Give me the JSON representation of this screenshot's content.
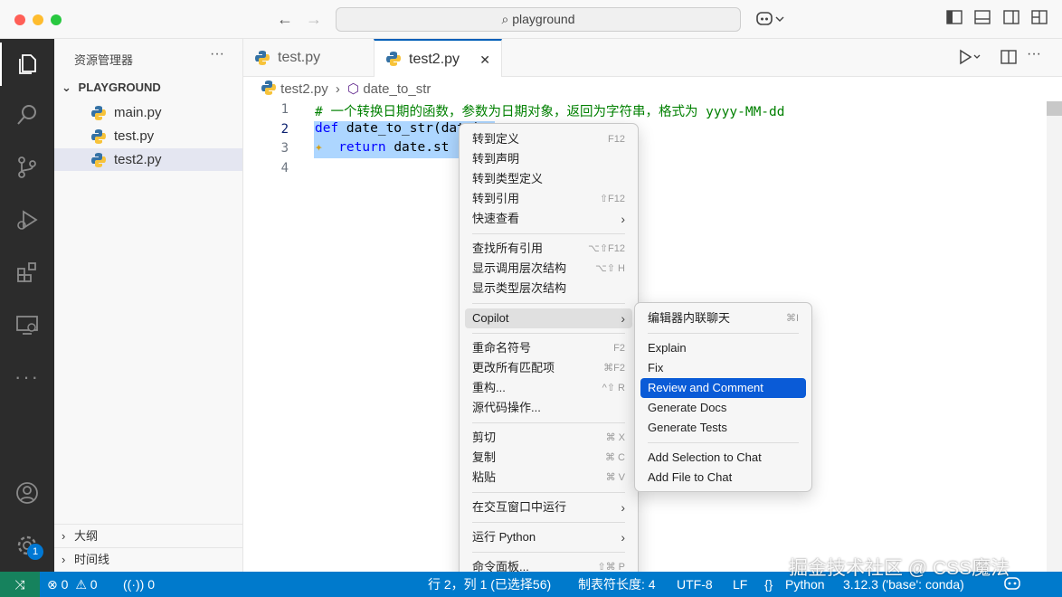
{
  "titlebar": {
    "search_text": "playground"
  },
  "sidebar": {
    "title": "资源管理器",
    "more": "···",
    "folder": "PLAYGROUND",
    "files": [
      "main.py",
      "test.py",
      "test2.py"
    ],
    "sections": [
      "大纲",
      "时间线"
    ]
  },
  "tabs": [
    {
      "label": "test.py"
    },
    {
      "label": "test2.py",
      "close": "✕"
    }
  ],
  "breadcrumb": {
    "file": "test2.py",
    "symbol": "date_to_str"
  },
  "editor": {
    "line_numbers": [
      "1",
      "2",
      "3",
      "4"
    ],
    "comment": "# 一个转换日期的函数，参数为日期对象，返回为字符串，格式为 yyyy-MM-dd",
    "line2_kw": "def",
    "line2_rest": " date_to_str(date):",
    "line3_kw": "return",
    "line3_rest": " date.st"
  },
  "context_menu": {
    "items": [
      {
        "label": "转到定义",
        "key": "F12"
      },
      {
        "label": "转到声明",
        "key": ""
      },
      {
        "label": "转到类型定义",
        "key": ""
      },
      {
        "label": "转到引用",
        "key": "⇧F12"
      },
      {
        "label": "快速查看",
        "key": "›"
      },
      {
        "label": "查找所有引用",
        "key": "⌥⇧F12"
      },
      {
        "label": "显示调用层次结构",
        "key": "⌥⇧ H"
      },
      {
        "label": "显示类型层次结构",
        "key": ""
      },
      {
        "label": "Copilot",
        "key": "›"
      },
      {
        "label": "重命名符号",
        "key": "F2"
      },
      {
        "label": "更改所有匹配项",
        "key": "⌘F2"
      },
      {
        "label": "重构...",
        "key": "^⇧ R"
      },
      {
        "label": "源代码操作...",
        "key": ""
      },
      {
        "label": "剪切",
        "key": "⌘ X"
      },
      {
        "label": "复制",
        "key": "⌘ C"
      },
      {
        "label": "粘贴",
        "key": "⌘ V"
      },
      {
        "label": "在交互窗口中运行",
        "key": "›"
      },
      {
        "label": "运行 Python",
        "key": "›"
      },
      {
        "label": "命令面板...",
        "key": "⇧⌘ P"
      }
    ]
  },
  "copilot_menu": {
    "items": [
      {
        "label": "编辑器内联聊天",
        "key": "⌘I"
      },
      {
        "label": "Explain",
        "key": ""
      },
      {
        "label": "Fix",
        "key": ""
      },
      {
        "label": "Review and Comment",
        "key": ""
      },
      {
        "label": "Generate Docs",
        "key": ""
      },
      {
        "label": "Generate Tests",
        "key": ""
      },
      {
        "label": "Add Selection to Chat",
        "key": ""
      },
      {
        "label": "Add File to Chat",
        "key": ""
      }
    ]
  },
  "status": {
    "errors": "0",
    "warnings": "0",
    "ports": "0",
    "cursor": "行 2，列 1 (已选择56)",
    "indent": "制表符长度: 4",
    "encoding": "UTF-8",
    "eol": "LF",
    "lang_icon": "{}",
    "language": "Python",
    "interpreter": "3.12.3 ('base': conda)"
  },
  "badge": "1",
  "watermark": "掘金技术社区 @ CSS魔法",
  "colors": {
    "accent": "#007acc",
    "selection": "#add6ff",
    "menu_highlight": "#0a5bd7",
    "comment": "#008000",
    "keyword": "#0000ff"
  }
}
